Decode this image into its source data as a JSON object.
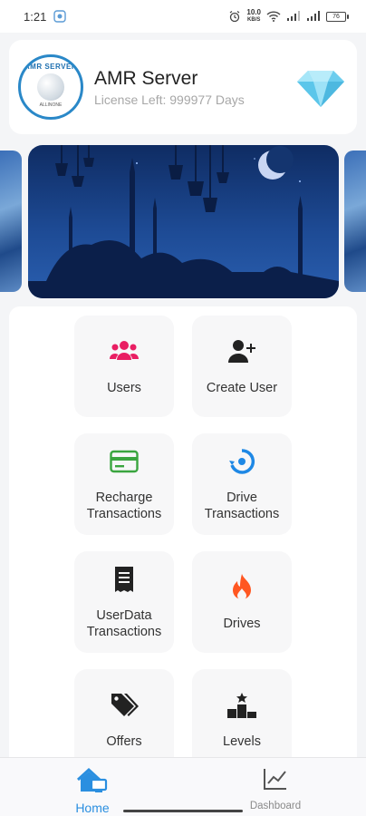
{
  "status_bar": {
    "time": "1:21",
    "network_speed": "10.0",
    "network_unit": "KB/S",
    "battery": "76"
  },
  "header": {
    "title": "AMR Server",
    "license": "License Left: 999977 Days",
    "avatar_text": "AMR SERVER",
    "avatar_subtext": "ALLINONE"
  },
  "menu": [
    {
      "label": "Users",
      "icon": "users-icon",
      "color": "#e91e63"
    },
    {
      "label": "Create User",
      "icon": "add-user-icon",
      "color": "#222222"
    },
    {
      "label": "Recharge Transactions",
      "icon": "credit-card-icon",
      "color": "#3aa53f"
    },
    {
      "label": "Drive Transactions",
      "icon": "drive-transaction-icon",
      "color": "#1e88e5"
    },
    {
      "label": "UserData Transactions",
      "icon": "receipt-icon",
      "color": "#222222"
    },
    {
      "label": "Drives",
      "icon": "fire-icon",
      "color": "#ff5722"
    },
    {
      "label": "Offers",
      "icon": "tags-icon",
      "color": "#222222"
    },
    {
      "label": "Levels",
      "icon": "podium-icon",
      "color": "#222222"
    }
  ],
  "bottom_nav": {
    "home_label": "Home",
    "dashboard_label": "Dashboard",
    "active_color": "#2b8fe0"
  }
}
